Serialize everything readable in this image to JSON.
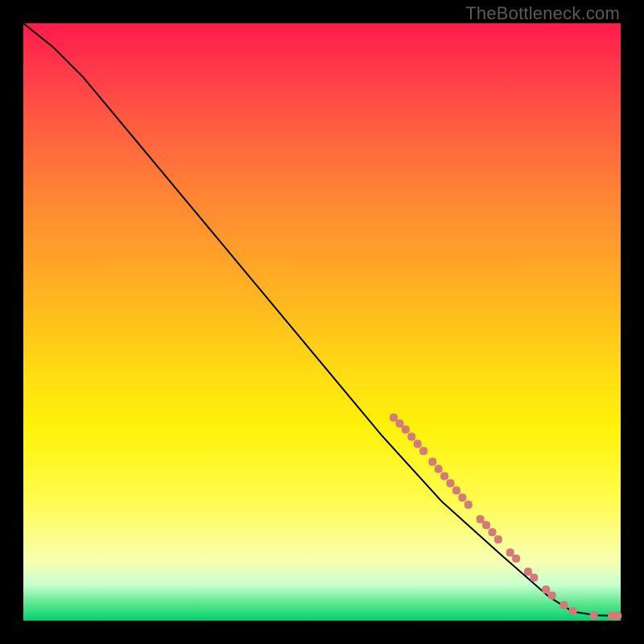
{
  "watermark": "TheBottleneck.com",
  "colors": {
    "curve_stroke": "#000000",
    "marker_fill": "#d47a78",
    "marker_stroke": "#c86a68"
  },
  "chart_data": {
    "type": "line",
    "title": "",
    "xlabel": "",
    "ylabel": "",
    "xlim": [
      0,
      100
    ],
    "ylim": [
      0,
      100
    ],
    "grid": false,
    "curve": [
      {
        "x": 0,
        "y": 100
      },
      {
        "x": 5,
        "y": 96
      },
      {
        "x": 10,
        "y": 91
      },
      {
        "x": 20,
        "y": 79
      },
      {
        "x": 30,
        "y": 67
      },
      {
        "x": 40,
        "y": 55
      },
      {
        "x": 50,
        "y": 43
      },
      {
        "x": 60,
        "y": 31
      },
      {
        "x": 70,
        "y": 20
      },
      {
        "x": 80,
        "y": 11
      },
      {
        "x": 88,
        "y": 4
      },
      {
        "x": 92,
        "y": 1.5
      },
      {
        "x": 96,
        "y": 0.9
      },
      {
        "x": 100,
        "y": 0.8
      }
    ],
    "marker_points": [
      {
        "x": 62,
        "y": 34
      },
      {
        "x": 63,
        "y": 33
      },
      {
        "x": 64,
        "y": 32
      },
      {
        "x": 65,
        "y": 30.8
      },
      {
        "x": 66,
        "y": 29.6
      },
      {
        "x": 67,
        "y": 28.4
      },
      {
        "x": 68.5,
        "y": 26.6
      },
      {
        "x": 69.5,
        "y": 25.4
      },
      {
        "x": 70.5,
        "y": 24.2
      },
      {
        "x": 71.5,
        "y": 23.0
      },
      {
        "x": 72.5,
        "y": 21.8
      },
      {
        "x": 73.5,
        "y": 20.6
      },
      {
        "x": 74.5,
        "y": 19.4
      },
      {
        "x": 76.5,
        "y": 17.0
      },
      {
        "x": 77.5,
        "y": 16.0
      },
      {
        "x": 78.5,
        "y": 14.8
      },
      {
        "x": 79.5,
        "y": 13.6
      },
      {
        "x": 81.5,
        "y": 11.4
      },
      {
        "x": 82.5,
        "y": 10.4
      },
      {
        "x": 84.5,
        "y": 8.2
      },
      {
        "x": 85.5,
        "y": 7.2
      },
      {
        "x": 87.5,
        "y": 5.2
      },
      {
        "x": 88.5,
        "y": 4.2
      },
      {
        "x": 90.5,
        "y": 2.6
      },
      {
        "x": 92.0,
        "y": 1.6
      },
      {
        "x": 95.5,
        "y": 0.9
      },
      {
        "x": 98.5,
        "y": 0.85
      },
      {
        "x": 99.5,
        "y": 0.8
      }
    ]
  }
}
